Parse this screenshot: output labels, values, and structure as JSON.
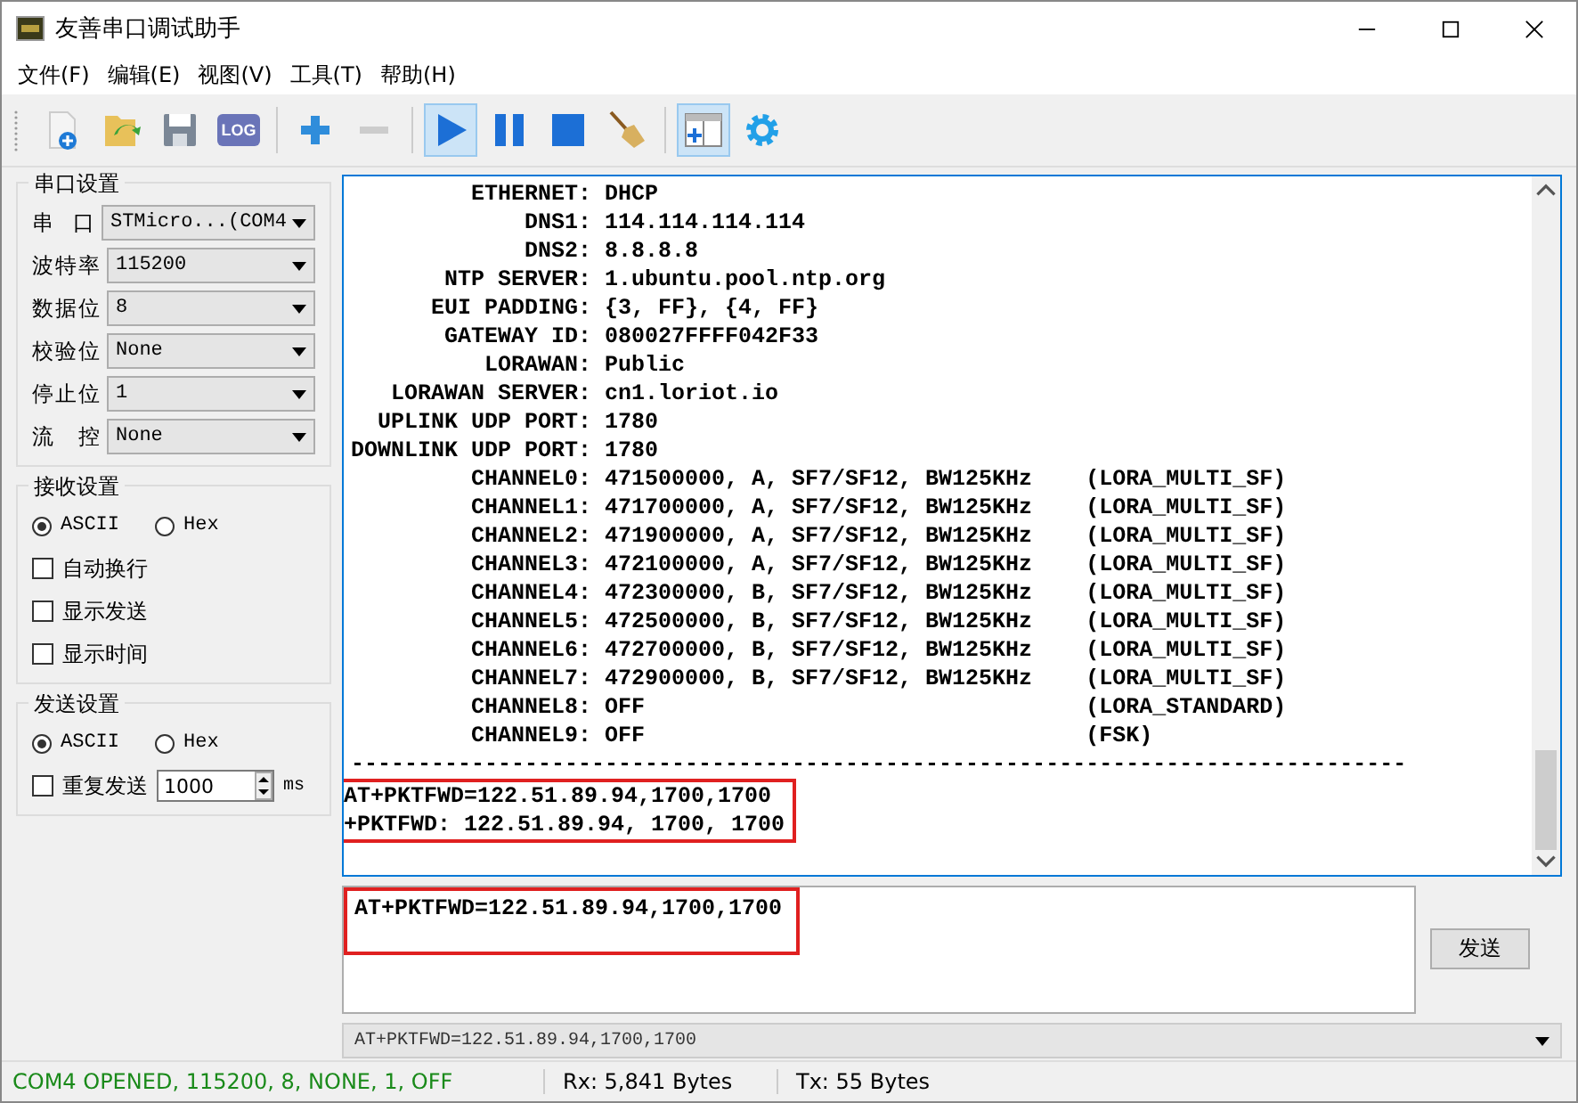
{
  "window": {
    "title": "友善串口调试助手"
  },
  "menu": [
    {
      "label": "文件(F)"
    },
    {
      "label": "编辑(E)"
    },
    {
      "label": "视图(V)"
    },
    {
      "label": "工具(T)"
    },
    {
      "label": "帮助(H)"
    }
  ],
  "toolbar": [
    {
      "kind": "new",
      "selected": false,
      "disabled": false
    },
    {
      "kind": "open",
      "selected": false,
      "disabled": false
    },
    {
      "kind": "save",
      "selected": false,
      "disabled": false
    },
    {
      "kind": "log",
      "label": "LOG",
      "selected": false,
      "disabled": false
    },
    {
      "kind": "sep"
    },
    {
      "kind": "add",
      "selected": false,
      "disabled": false
    },
    {
      "kind": "remove",
      "selected": false,
      "disabled": true
    },
    {
      "kind": "sep"
    },
    {
      "kind": "play",
      "selected": true,
      "disabled": false
    },
    {
      "kind": "pause",
      "selected": false,
      "disabled": false
    },
    {
      "kind": "stop",
      "selected": false,
      "disabled": false
    },
    {
      "kind": "broom",
      "selected": false,
      "disabled": false
    },
    {
      "kind": "sep"
    },
    {
      "kind": "layout",
      "selected": true,
      "disabled": false
    },
    {
      "kind": "gear",
      "selected": false,
      "disabled": false
    }
  ],
  "serial_settings": {
    "title": "串口设置",
    "fields": [
      {
        "label": "串 口",
        "value": "STMicro...(COM4"
      },
      {
        "label": "波特率",
        "value": "115200"
      },
      {
        "label": "数据位",
        "value": "8"
      },
      {
        "label": "校验位",
        "value": "None"
      },
      {
        "label": "停止位",
        "value": "1"
      },
      {
        "label": "流 控",
        "value": "None"
      }
    ]
  },
  "receive_settings": {
    "title": "接收设置",
    "radios": [
      {
        "label": "ASCII",
        "selected": true
      },
      {
        "label": "Hex",
        "selected": false
      }
    ],
    "checkboxes": [
      {
        "label": "自动换行",
        "checked": false
      },
      {
        "label": "显示发送",
        "checked": false
      },
      {
        "label": "显示时间",
        "checked": false
      }
    ]
  },
  "send_settings": {
    "title": "发送设置",
    "radios": [
      {
        "label": "ASCII",
        "selected": true
      },
      {
        "label": "Hex",
        "selected": false
      }
    ],
    "repeat": {
      "label": "重复发送",
      "checked": false,
      "interval": "1000",
      "unit": "ms"
    }
  },
  "receive_log": {
    "lines": [
      "         ETHERNET: DHCP",
      "             DNS1: 114.114.114.114",
      "             DNS2: 8.8.8.8",
      "       NTP SERVER: 1.ubuntu.pool.ntp.org",
      "      EUI PADDING: {3, FF}, {4, FF}",
      "       GATEWAY ID: 080027FFFF042F33",
      "          LORAWAN: Public",
      "   LORAWAN SERVER: cn1.loriot.io",
      "  UPLINK UDP PORT: 1780",
      "DOWNLINK UDP PORT: 1780",
      "         CHANNEL0: 471500000, A, SF7/SF12, BW125KHz    (LORA_MULTI_SF)",
      "         CHANNEL1: 471700000, A, SF7/SF12, BW125KHz    (LORA_MULTI_SF)",
      "         CHANNEL2: 471900000, A, SF7/SF12, BW125KHz    (LORA_MULTI_SF)",
      "         CHANNEL3: 472100000, A, SF7/SF12, BW125KHz    (LORA_MULTI_SF)",
      "         CHANNEL4: 472300000, B, SF7/SF12, BW125KHz    (LORA_MULTI_SF)",
      "         CHANNEL5: 472500000, B, SF7/SF12, BW125KHz    (LORA_MULTI_SF)",
      "         CHANNEL6: 472700000, B, SF7/SF12, BW125KHz    (LORA_MULTI_SF)",
      "         CHANNEL7: 472900000, B, SF7/SF12, BW125KHz    (LORA_MULTI_SF)",
      "         CHANNEL8: OFF                                 (LORA_STANDARD)",
      "         CHANNEL9: OFF                                 (FSK)",
      "-------------------------------------------------------------------------------"
    ],
    "highlighted_lines": [
      "AT+PKTFWD=122.51.89.94,1700,1700",
      "+PKTFWD: 122.51.89.94, 1700, 1700"
    ]
  },
  "send_input": {
    "value": "AT+PKTFWD=122.51.89.94,1700,1700"
  },
  "send_button": {
    "label": "发送"
  },
  "history": {
    "value": "AT+PKTFWD=122.51.89.94,1700,1700"
  },
  "status_bar": {
    "connection": "COM4 OPENED, 115200, 8, NONE, 1, OFF",
    "rx": "Rx: 5,841 Bytes",
    "tx": "Tx: 55 Bytes"
  }
}
